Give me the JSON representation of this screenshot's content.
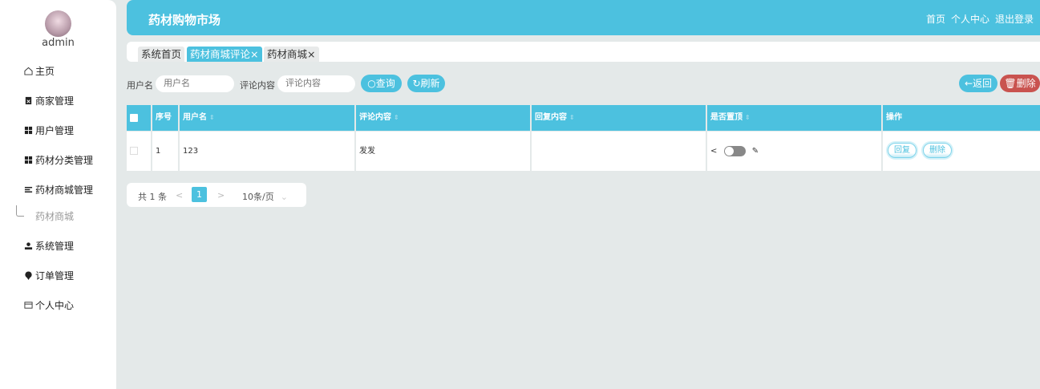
{
  "user": {
    "name": "admin"
  },
  "sidebar": {
    "items": [
      {
        "label": "主页",
        "icon": "home-icon"
      },
      {
        "label": "商家管理",
        "icon": "clipboard-icon"
      },
      {
        "label": "用户管理",
        "icon": "grid-icon"
      },
      {
        "label": "药材分类管理",
        "icon": "grid-icon"
      },
      {
        "label": "药材商城管理",
        "icon": "list-icon"
      },
      {
        "label": "系统管理",
        "icon": "user-icon"
      },
      {
        "label": "订单管理",
        "icon": "pin-icon"
      },
      {
        "label": "个人中心",
        "icon": "wallet-icon"
      }
    ],
    "sub_item": "药材商城"
  },
  "header": {
    "title": "药材购物市场",
    "links": [
      "首页",
      "个人中心",
      "退出登录"
    ]
  },
  "tabs": [
    {
      "label": "系统首页"
    },
    {
      "label": "药材商城评论",
      "close": "×"
    },
    {
      "label": "药材商城",
      "close": "×"
    }
  ],
  "search": {
    "username_label": "用户名",
    "username_placeholder": "用户名",
    "content_label": "评论内容",
    "content_placeholder": "评论内容",
    "query": "查询",
    "refresh": "刷新",
    "back": "返回",
    "delete": "删除"
  },
  "table": {
    "headers": [
      "序号",
      "用户名",
      "评论内容",
      "回复内容",
      "是否置顶",
      "操作"
    ],
    "rows": [
      {
        "index": "1",
        "username": "123",
        "content": "发发",
        "reply": "",
        "pinned": false,
        "actions": [
          "回复",
          "删除"
        ]
      }
    ]
  },
  "pagination": {
    "total": "共 1 条",
    "page": "1",
    "prev": "<",
    "next": ">",
    "page_size": "10条/页"
  },
  "colors": {
    "accent": "#4cc1df",
    "danger": "#c9534f",
    "background": "#e4e9e9"
  }
}
